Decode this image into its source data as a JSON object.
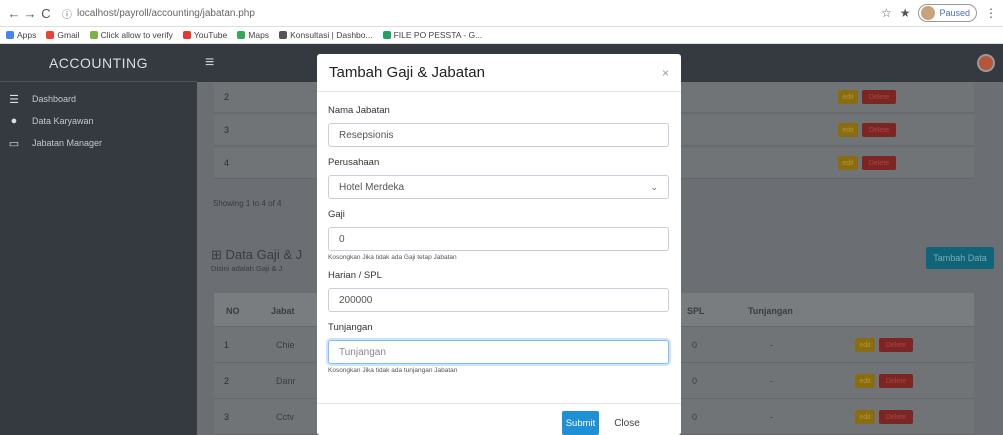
{
  "browser": {
    "url": "localhost/payroll/accounting/jabatan.php",
    "paused_label": "Paused",
    "bookmarks": [
      "Apps",
      "Gmail",
      "Click allow to verify",
      "YouTube",
      "Maps",
      "Konsultasi | Dashbo...",
      "FILE PO PESSTA - G..."
    ]
  },
  "sidebar": {
    "brand": "ACCOUNTING",
    "items": [
      {
        "label": "Dashboard",
        "icon": "list-icon"
      },
      {
        "label": "Data Karyawan",
        "icon": "user-icon"
      },
      {
        "label": "Jabatan Manager",
        "icon": "laptop-icon"
      }
    ]
  },
  "background": {
    "top_rows": [
      "2",
      "3",
      "4"
    ],
    "showing_text": "Showing 1 to 4 of 4",
    "section_title": "Data Gaji & J",
    "section_sub": "Disini adalah Gaji & J",
    "tambah_data_label": "Tambah Data",
    "table_headers": {
      "no": "NO",
      "jabatan": "Jabat",
      "spl": "SPL",
      "tunjangan": "Tunjangan"
    },
    "bottom_rows": [
      {
        "no": "1",
        "jab": "Chie",
        "spl": "0",
        "tunj": "-"
      },
      {
        "no": "2",
        "jab": "Danr",
        "spl": "0",
        "tunj": "-"
      },
      {
        "no": "3",
        "jab": "Cctv",
        "spl": "0",
        "tunj": "-"
      }
    ],
    "edit_label": "edit",
    "delete_label": "Delete"
  },
  "modal": {
    "title": "Tambah Gaji & Jabatan",
    "close_symbol": "×",
    "fields": {
      "nama_jabatan": {
        "label": "Nama Jabatan",
        "value": "Resepsionis"
      },
      "perusahaan": {
        "label": "Perusahaan",
        "value": "Hotel Merdeka"
      },
      "gaji": {
        "label": "Gaji",
        "value": "0",
        "help": "Kosongkan Jika tidak ada Gaji tetap Jabatan"
      },
      "harian": {
        "label": "Harian / SPL",
        "value": "200000"
      },
      "tunjangan": {
        "label": "Tunjangan",
        "placeholder": "Tunjangan",
        "help": "Kosongkan Jika tidak ada tunjangan Jabatan"
      }
    },
    "submit_label": "Submit",
    "close_label": "Close"
  },
  "colors": {
    "sidebar": "#343a40",
    "primary": "#1e90d6",
    "danger": "#dc3545",
    "warning": "#ffc107",
    "info": "#17a2b8"
  }
}
